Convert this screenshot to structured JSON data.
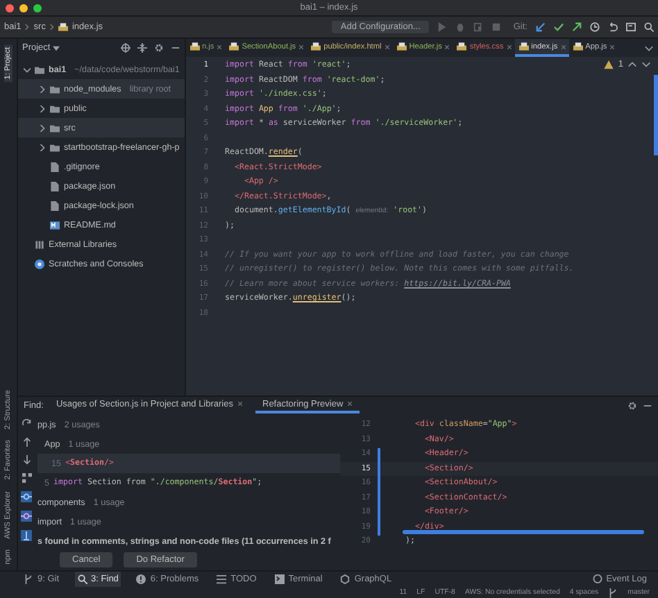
{
  "window": {
    "title": "bai1 – index.js"
  },
  "breadcrumbs": [
    "bai1",
    "src",
    "index.js"
  ],
  "toolbar": {
    "run_config": "Add Configuration...",
    "vcs_label": "Git:"
  },
  "side_stripe": {
    "top": [
      {
        "label": "1: Project",
        "selected": true
      }
    ],
    "bottom": [
      {
        "label": "2: Structure",
        "selected": false
      },
      {
        "label": "2: Favorites",
        "selected": false
      },
      {
        "label": "AWS Explorer",
        "selected": false
      },
      {
        "label": "npm",
        "selected": false
      }
    ]
  },
  "project": {
    "title": "Project",
    "tree": [
      {
        "kind": "folder",
        "label": "bai1",
        "detail": "~/data/code/webstorm/bai1",
        "expanded": true,
        "selected": false,
        "children": [
          {
            "kind": "folder",
            "label": "node_modules",
            "detail": "library root",
            "expanded": false,
            "selected": true
          },
          {
            "kind": "folder",
            "label": "public",
            "expanded": false,
            "selected": false
          },
          {
            "kind": "folder",
            "label": "src",
            "expanded": false,
            "selected": true
          },
          {
            "kind": "folder",
            "label": "startbootstrap-freelancer-gh-p",
            "expanded": false,
            "selected": false
          },
          {
            "kind": "file",
            "label": ".gitignore",
            "selected": false
          },
          {
            "kind": "file",
            "label": "package.json",
            "selected": false
          },
          {
            "kind": "file",
            "label": "package-lock.json",
            "selected": false
          },
          {
            "kind": "markdown",
            "label": "README.md",
            "selected": false
          }
        ]
      },
      {
        "kind": "library",
        "label": "External Libraries",
        "selected": false
      },
      {
        "kind": "scratch",
        "label": "Scratches and Consoles",
        "selected": false
      }
    ]
  },
  "editor": {
    "tabs": [
      {
        "label": "n.js",
        "selected": false,
        "color": "#8a9a7a"
      },
      {
        "label": "SectionAbout.js",
        "selected": false,
        "color": "#8fb55e"
      },
      {
        "label": "public/index.html",
        "selected": false,
        "color": "#c9b26b"
      },
      {
        "label": "Header.js",
        "selected": false,
        "color": "#8fb55e"
      },
      {
        "label": "styles.css",
        "selected": false,
        "color": "#d2615f"
      },
      {
        "label": "index.js",
        "selected": true,
        "color": "#d4d4d4"
      },
      {
        "label": "App.js",
        "selected": false,
        "color": "#bbbbbb"
      }
    ],
    "warning_count": "1",
    "lines": [
      {
        "n": "1",
        "current": true,
        "tokens": [
          {
            "kind": "kw",
            "text": "import"
          },
          {
            "kind": "plain",
            "text": " React "
          },
          {
            "kind": "kw",
            "text": "from"
          },
          {
            "kind": "str",
            "text": " 'react'"
          },
          {
            "kind": "plain",
            "text": ";"
          }
        ]
      },
      {
        "n": "2",
        "current": false,
        "tokens": [
          {
            "kind": "kw",
            "text": "import"
          },
          {
            "kind": "plain",
            "text": " ReactDOM "
          },
          {
            "kind": "kw",
            "text": "from"
          },
          {
            "kind": "str",
            "text": " 'react-dom'"
          },
          {
            "kind": "plain",
            "text": ";"
          }
        ]
      },
      {
        "n": "3",
        "current": false,
        "tokens": [
          {
            "kind": "kw",
            "text": "import"
          },
          {
            "kind": "str",
            "text": " './index.css'"
          },
          {
            "kind": "plain",
            "text": ";"
          }
        ]
      },
      {
        "n": "4",
        "current": false,
        "tokens": [
          {
            "kind": "kw",
            "text": "import"
          },
          {
            "kind": "ident",
            "text": " App "
          },
          {
            "kind": "kw",
            "text": "from"
          },
          {
            "kind": "str",
            "text": " './App'"
          },
          {
            "kind": "plain",
            "text": ";"
          }
        ]
      },
      {
        "n": "5",
        "current": false,
        "tokens": [
          {
            "kind": "kw",
            "text": "import"
          },
          {
            "kind": "plain",
            "text": " * "
          },
          {
            "kind": "kw",
            "text": "as"
          },
          {
            "kind": "plain",
            "text": " serviceWorker "
          },
          {
            "kind": "kw",
            "text": "from"
          },
          {
            "kind": "str",
            "text": " './serviceWorker'"
          },
          {
            "kind": "plain",
            "text": ";"
          }
        ]
      },
      {
        "n": "6",
        "current": false
      },
      {
        "n": "7",
        "current": false,
        "tokens": [
          {
            "kind": "plain",
            "text": "ReactDOM."
          },
          {
            "kind": "fn",
            "text": "render"
          },
          {
            "kind": "plain",
            "text": "("
          }
        ]
      },
      {
        "n": "8",
        "current": false,
        "tokens": [
          {
            "kind": "tag",
            "text": "  <React.StrictMode>"
          }
        ]
      },
      {
        "n": "9",
        "current": false,
        "tokens": [
          {
            "kind": "tag",
            "text": "    <App />"
          }
        ]
      },
      {
        "n": "10",
        "current": false,
        "tokens": [
          {
            "kind": "tag",
            "text": "  </React.StrictMode>"
          },
          {
            "kind": "plain",
            "text": ","
          }
        ]
      },
      {
        "n": "11",
        "current": false,
        "tokens": [
          {
            "kind": "plain",
            "text": "  document."
          },
          {
            "kind": "method",
            "text": "getElementById"
          },
          {
            "kind": "plain",
            "text": "( "
          },
          {
            "kind": "hint",
            "text": "elementId:"
          },
          {
            "kind": "str",
            "text": " 'root'"
          },
          {
            "kind": "plain",
            "text": ")"
          }
        ]
      },
      {
        "n": "12",
        "current": false,
        "tokens": [
          {
            "kind": "plain",
            "text": ");"
          }
        ]
      },
      {
        "n": "13",
        "current": false
      },
      {
        "n": "14",
        "current": false,
        "tokens": [
          {
            "kind": "comment",
            "text": "// If you want your app to work offline and load faster, you can change"
          }
        ]
      },
      {
        "n": "15",
        "current": false,
        "tokens": [
          {
            "kind": "comment",
            "text": "// unregister() to register() below. Note this comes with some pitfalls."
          }
        ]
      },
      {
        "n": "16",
        "current": false,
        "tokens": [
          {
            "kind": "comment",
            "text": "// Learn more about service workers: "
          },
          {
            "kind": "link",
            "text": "https://bit.ly/CRA-PWA"
          }
        ]
      },
      {
        "n": "17",
        "current": false,
        "tokens": [
          {
            "kind": "plain",
            "text": "serviceWorker."
          },
          {
            "kind": "fn",
            "text": "unregister"
          },
          {
            "kind": "plain",
            "text": "();"
          }
        ]
      },
      {
        "n": "18",
        "current": false
      }
    ]
  },
  "find_panel": {
    "label": "Find:",
    "tabs": [
      {
        "label": "Usages of Section.js in Project and Libraries",
        "selected": false
      },
      {
        "label": "Refactoring Preview",
        "selected": true
      }
    ],
    "usages": [
      {
        "kind": "group",
        "label": "pp.js",
        "count": "2 usages",
        "selected": false,
        "children": [
          {
            "kind": "group",
            "label": "App",
            "count": "1 usage",
            "selected": false,
            "children": [
              {
                "kind": "code",
                "line": "15",
                "selected": true,
                "tokens": [
                  {
                    "kind": "tag",
                    "text": "<"
                  },
                  {
                    "kind": "match",
                    "text": "Section"
                  },
                  {
                    "kind": "tag",
                    "text": "/>"
                  }
                ]
              }
            ]
          },
          {
            "kind": "code",
            "line": "5",
            "selected": false,
            "tokens": [
              {
                "kind": "kw",
                "text": "import"
              },
              {
                "kind": "plain",
                "text": " Section from "
              },
              {
                "kind": "str",
                "text": "\"./components/"
              },
              {
                "kind": "match",
                "text": "Section"
              },
              {
                "kind": "str",
                "text": "\""
              },
              {
                "kind": "plain",
                "text": ";"
              }
            ]
          }
        ]
      },
      {
        "kind": "group",
        "label": "components",
        "count": "1 usage",
        "selected": false
      },
      {
        "kind": "group",
        "label": "import",
        "count": "1 usage",
        "selected": false
      },
      {
        "kind": "note",
        "label": "s found in comments, strings and non-code files  (11 occurrences in 2 f",
        "selected": false
      }
    ],
    "preview": [
      {
        "n": "12",
        "current": false,
        "tokens": [
          {
            "kind": "tag",
            "text": "    <div"
          },
          {
            "kind": "attr",
            "text": " className"
          },
          {
            "kind": "plain",
            "text": "="
          },
          {
            "kind": "str",
            "text": "\"App\""
          },
          {
            "kind": "tag",
            "text": ">"
          }
        ]
      },
      {
        "n": "13",
        "current": false,
        "tokens": [
          {
            "kind": "tag",
            "text": "      <Nav/>"
          }
        ]
      },
      {
        "n": "14",
        "current": false,
        "tokens": [
          {
            "kind": "tag",
            "text": "      <Header/>"
          }
        ]
      },
      {
        "n": "15",
        "current": true,
        "tokens": [
          {
            "kind": "tag",
            "text": "      <Section/>"
          }
        ]
      },
      {
        "n": "16",
        "current": false,
        "tokens": [
          {
            "kind": "tag",
            "text": "      <SectionAbout/>"
          }
        ]
      },
      {
        "n": "17",
        "current": false,
        "tokens": [
          {
            "kind": "tag",
            "text": "      <SectionContact/>"
          }
        ]
      },
      {
        "n": "18",
        "current": false,
        "tokens": [
          {
            "kind": "tag",
            "text": "      <Footer/>"
          }
        ]
      },
      {
        "n": "19",
        "current": false,
        "tokens": [
          {
            "kind": "tag",
            "text": "    </div>"
          }
        ]
      },
      {
        "n": "20",
        "current": false,
        "tokens": [
          {
            "kind": "plain",
            "text": "  );"
          }
        ]
      }
    ],
    "buttons": [
      "Cancel",
      "Do Refactor"
    ]
  },
  "tool_windows": [
    {
      "kind": "git",
      "label": "9: Git",
      "selected": false
    },
    {
      "kind": "find",
      "label": "3: Find",
      "selected": true
    },
    {
      "kind": "problems",
      "label": "6: Problems",
      "selected": false
    },
    {
      "kind": "todo",
      "label": "TODO",
      "selected": false
    },
    {
      "kind": "terminal",
      "label": "Terminal",
      "selected": false
    },
    {
      "kind": "graphql",
      "label": "GraphQL",
      "selected": false
    }
  ],
  "event_log": "Event Log",
  "status_bar": {
    "items": [
      "11",
      "LF",
      "UTF-8",
      "AWS: No credentials selected",
      "4 spaces"
    ],
    "branch": "master"
  }
}
